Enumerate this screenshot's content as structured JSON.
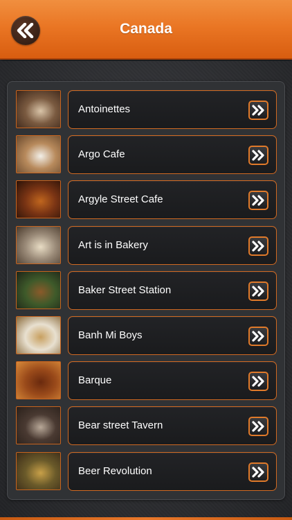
{
  "header": {
    "title": "Canada",
    "back_icon": "double-chevron-left-icon",
    "accent_color": "#ea7624"
  },
  "list": {
    "items": [
      {
        "label": "Antoinettes",
        "thumb_colors": [
          "#7a5a40",
          "#d9c4a8",
          "#3a2418"
        ]
      },
      {
        "label": "Argo Cafe",
        "thumb_colors": [
          "#b88a5c",
          "#f2efe8",
          "#6a4a2e"
        ]
      },
      {
        "label": "Argyle Street Cafe",
        "thumb_colors": [
          "#7a3414",
          "#c0661e",
          "#2a1208"
        ]
      },
      {
        "label": "Art is in Bakery",
        "thumb_colors": [
          "#9a8a78",
          "#e8dcc4",
          "#4a3a2c"
        ]
      },
      {
        "label": "Baker Street Station",
        "thumb_colors": [
          "#3e5a2a",
          "#8a5a2a",
          "#1e2418"
        ]
      },
      {
        "label": "Banh Mi Boys",
        "thumb_colors": [
          "#e8e0d0",
          "#c8a060",
          "#8a6a3a"
        ]
      },
      {
        "label": "Barque",
        "thumb_colors": [
          "#9a4a1a",
          "#6a2a0e",
          "#d88a3a"
        ]
      },
      {
        "label": "Bear street Tavern",
        "thumb_colors": [
          "#4a3a32",
          "#b8a898",
          "#2a201a"
        ]
      },
      {
        "label": "Beer Revolution",
        "thumb_colors": [
          "#6a5a2a",
          "#c8a048",
          "#3a2a18"
        ]
      }
    ],
    "arrow_icon": "double-chevron-right-icon"
  }
}
